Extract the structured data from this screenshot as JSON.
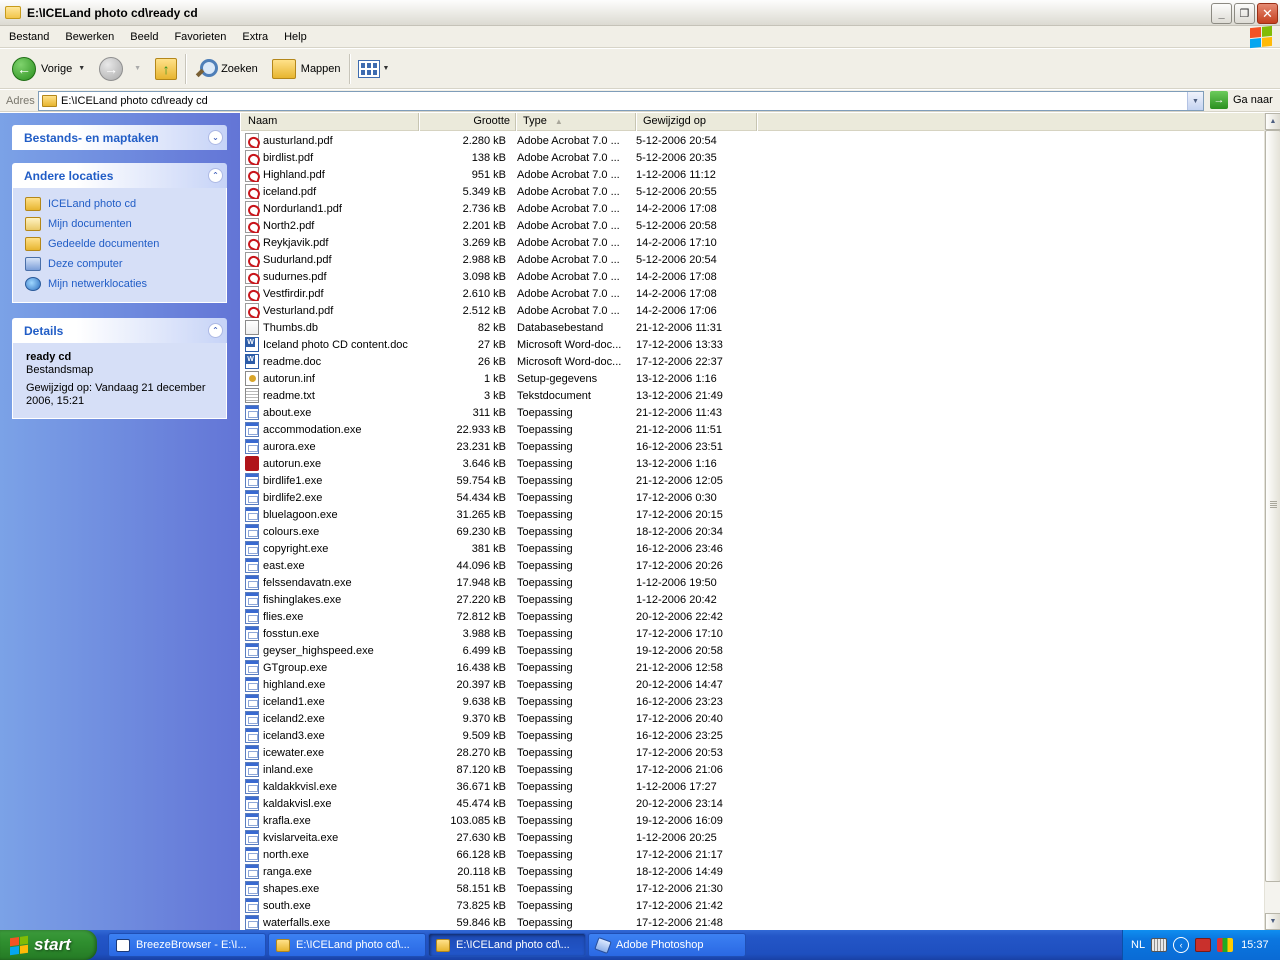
{
  "window": {
    "title": "E:\\ICELand photo cd\\ready cd",
    "minimize": "_",
    "maximize": "❐",
    "close": "✕"
  },
  "menu": [
    "Bestand",
    "Bewerken",
    "Beeld",
    "Favorieten",
    "Extra",
    "Help"
  ],
  "toolbar": {
    "back_label": "Vorige",
    "search_label": "Zoeken",
    "folders_label": "Mappen"
  },
  "address": {
    "label": "Adres",
    "value": "E:\\ICELand photo cd\\ready cd",
    "go_label": "Ga naar"
  },
  "taskpane": {
    "file_tasks_title": "Bestands- en maptaken",
    "other_locations_title": "Andere locaties",
    "other_locations": [
      {
        "label": "ICELand photo cd",
        "icon": "folder-icon"
      },
      {
        "label": "Mijn documenten",
        "icon": "my-documents-icon"
      },
      {
        "label": "Gedeelde documenten",
        "icon": "shared-documents-icon"
      },
      {
        "label": "Deze computer",
        "icon": "computer-icon"
      },
      {
        "label": "Mijn netwerklocaties",
        "icon": "network-icon"
      }
    ],
    "details_title": "Details",
    "details": {
      "name": "ready cd",
      "kind": "Bestandsmap",
      "modified": "Gewijzigd op: Vandaag 21 december 2006, 15:21"
    }
  },
  "columns": {
    "name": "Naam",
    "size": "Grootte",
    "type": "Type",
    "modified": "Gewijzigd op"
  },
  "files": [
    {
      "name": "austurland.pdf",
      "size": "2.280 kB",
      "type": "Adobe Acrobat 7.0 ...",
      "modified": "5-12-2006 20:54",
      "icon": "pdf"
    },
    {
      "name": "birdlist.pdf",
      "size": "138 kB",
      "type": "Adobe Acrobat 7.0 ...",
      "modified": "5-12-2006 20:35",
      "icon": "pdf"
    },
    {
      "name": "Highland.pdf",
      "size": "951 kB",
      "type": "Adobe Acrobat 7.0 ...",
      "modified": "1-12-2006 11:12",
      "icon": "pdf"
    },
    {
      "name": "iceland.pdf",
      "size": "5.349 kB",
      "type": "Adobe Acrobat 7.0 ...",
      "modified": "5-12-2006 20:55",
      "icon": "pdf"
    },
    {
      "name": "Nordurland1.pdf",
      "size": "2.736 kB",
      "type": "Adobe Acrobat 7.0 ...",
      "modified": "14-2-2006 17:08",
      "icon": "pdf"
    },
    {
      "name": "North2.pdf",
      "size": "2.201 kB",
      "type": "Adobe Acrobat 7.0 ...",
      "modified": "5-12-2006 20:58",
      "icon": "pdf"
    },
    {
      "name": "Reykjavik.pdf",
      "size": "3.269 kB",
      "type": "Adobe Acrobat 7.0 ...",
      "modified": "14-2-2006 17:10",
      "icon": "pdf"
    },
    {
      "name": "Sudurland.pdf",
      "size": "2.988 kB",
      "type": "Adobe Acrobat 7.0 ...",
      "modified": "5-12-2006 20:54",
      "icon": "pdf"
    },
    {
      "name": "sudurnes.pdf",
      "size": "3.098 kB",
      "type": "Adobe Acrobat 7.0 ...",
      "modified": "14-2-2006 17:08",
      "icon": "pdf"
    },
    {
      "name": "Vestfirdir.pdf",
      "size": "2.610 kB",
      "type": "Adobe Acrobat 7.0 ...",
      "modified": "14-2-2006 17:08",
      "icon": "pdf"
    },
    {
      "name": "Vesturland.pdf",
      "size": "2.512 kB",
      "type": "Adobe Acrobat 7.0 ...",
      "modified": "14-2-2006 17:06",
      "icon": "pdf"
    },
    {
      "name": "Thumbs.db",
      "size": "82 kB",
      "type": "Databasebestand",
      "modified": "21-12-2006 11:31",
      "icon": "db"
    },
    {
      "name": "Iceland photo CD content.doc",
      "size": "27 kB",
      "type": "Microsoft Word-doc...",
      "modified": "17-12-2006 13:33",
      "icon": "doc"
    },
    {
      "name": "readme.doc",
      "size": "26 kB",
      "type": "Microsoft Word-doc...",
      "modified": "17-12-2006 22:37",
      "icon": "doc"
    },
    {
      "name": "autorun.inf",
      "size": "1 kB",
      "type": "Setup-gegevens",
      "modified": "13-12-2006 1:16",
      "icon": "inf"
    },
    {
      "name": "readme.txt",
      "size": "3 kB",
      "type": "Tekstdocument",
      "modified": "13-12-2006 21:49",
      "icon": "txt"
    },
    {
      "name": "about.exe",
      "size": "311 kB",
      "type": "Toepassing",
      "modified": "21-12-2006 11:43",
      "icon": "exe"
    },
    {
      "name": "accommodation.exe",
      "size": "22.933 kB",
      "type": "Toepassing",
      "modified": "21-12-2006 11:51",
      "icon": "exe"
    },
    {
      "name": "aurora.exe",
      "size": "23.231 kB",
      "type": "Toepassing",
      "modified": "16-12-2006 23:51",
      "icon": "exe"
    },
    {
      "name": "autorun.exe",
      "size": "3.646 kB",
      "type": "Toepassing",
      "modified": "13-12-2006 1:16",
      "icon": "app"
    },
    {
      "name": "birdlife1.exe",
      "size": "59.754 kB",
      "type": "Toepassing",
      "modified": "21-12-2006 12:05",
      "icon": "exe"
    },
    {
      "name": "birdlife2.exe",
      "size": "54.434 kB",
      "type": "Toepassing",
      "modified": "17-12-2006 0:30",
      "icon": "exe"
    },
    {
      "name": "bluelagoon.exe",
      "size": "31.265 kB",
      "type": "Toepassing",
      "modified": "17-12-2006 20:15",
      "icon": "exe"
    },
    {
      "name": "colours.exe",
      "size": "69.230 kB",
      "type": "Toepassing",
      "modified": "18-12-2006 20:34",
      "icon": "exe"
    },
    {
      "name": "copyright.exe",
      "size": "381 kB",
      "type": "Toepassing",
      "modified": "16-12-2006 23:46",
      "icon": "exe"
    },
    {
      "name": "east.exe",
      "size": "44.096 kB",
      "type": "Toepassing",
      "modified": "17-12-2006 20:26",
      "icon": "exe"
    },
    {
      "name": "felssendavatn.exe",
      "size": "17.948 kB",
      "type": "Toepassing",
      "modified": "1-12-2006 19:50",
      "icon": "exe"
    },
    {
      "name": "fishinglakes.exe",
      "size": "27.220 kB",
      "type": "Toepassing",
      "modified": "1-12-2006 20:42",
      "icon": "exe"
    },
    {
      "name": "flies.exe",
      "size": "72.812 kB",
      "type": "Toepassing",
      "modified": "20-12-2006 22:42",
      "icon": "exe"
    },
    {
      "name": "fosstun.exe",
      "size": "3.988 kB",
      "type": "Toepassing",
      "modified": "17-12-2006 17:10",
      "icon": "exe"
    },
    {
      "name": "geyser_highspeed.exe",
      "size": "6.499 kB",
      "type": "Toepassing",
      "modified": "19-12-2006 20:58",
      "icon": "exe"
    },
    {
      "name": "GTgroup.exe",
      "size": "16.438 kB",
      "type": "Toepassing",
      "modified": "21-12-2006 12:58",
      "icon": "exe"
    },
    {
      "name": "highland.exe",
      "size": "20.397 kB",
      "type": "Toepassing",
      "modified": "20-12-2006 14:47",
      "icon": "exe"
    },
    {
      "name": "iceland1.exe",
      "size": "9.638 kB",
      "type": "Toepassing",
      "modified": "16-12-2006 23:23",
      "icon": "exe"
    },
    {
      "name": "iceland2.exe",
      "size": "9.370 kB",
      "type": "Toepassing",
      "modified": "17-12-2006 20:40",
      "icon": "exe"
    },
    {
      "name": "iceland3.exe",
      "size": "9.509 kB",
      "type": "Toepassing",
      "modified": "16-12-2006 23:25",
      "icon": "exe"
    },
    {
      "name": "icewater.exe",
      "size": "28.270 kB",
      "type": "Toepassing",
      "modified": "17-12-2006 20:53",
      "icon": "exe"
    },
    {
      "name": "inland.exe",
      "size": "87.120 kB",
      "type": "Toepassing",
      "modified": "17-12-2006 21:06",
      "icon": "exe"
    },
    {
      "name": "kaldakkvisl.exe",
      "size": "36.671 kB",
      "type": "Toepassing",
      "modified": "1-12-2006 17:27",
      "icon": "exe"
    },
    {
      "name": "kaldakvisl.exe",
      "size": "45.474 kB",
      "type": "Toepassing",
      "modified": "20-12-2006 23:14",
      "icon": "exe"
    },
    {
      "name": "krafla.exe",
      "size": "103.085 kB",
      "type": "Toepassing",
      "modified": "19-12-2006 16:09",
      "icon": "exe"
    },
    {
      "name": "kvislarveita.exe",
      "size": "27.630 kB",
      "type": "Toepassing",
      "modified": "1-12-2006 20:25",
      "icon": "exe"
    },
    {
      "name": "north.exe",
      "size": "66.128 kB",
      "type": "Toepassing",
      "modified": "17-12-2006 21:17",
      "icon": "exe"
    },
    {
      "name": "ranga.exe",
      "size": "20.118 kB",
      "type": "Toepassing",
      "modified": "18-12-2006 14:49",
      "icon": "exe"
    },
    {
      "name": "shapes.exe",
      "size": "58.151 kB",
      "type": "Toepassing",
      "modified": "17-12-2006 21:30",
      "icon": "exe"
    },
    {
      "name": "south.exe",
      "size": "73.825 kB",
      "type": "Toepassing",
      "modified": "17-12-2006 21:42",
      "icon": "exe"
    },
    {
      "name": "waterfalls.exe",
      "size": "59.846 kB",
      "type": "Toepassing",
      "modified": "17-12-2006 21:48",
      "icon": "exe"
    }
  ],
  "taskbar": {
    "start_label": "start",
    "tasks": [
      {
        "label": "BreezeBrowser - E:\\I...",
        "icon": "breeze",
        "active": false
      },
      {
        "label": "E:\\ICELand photo cd\\...",
        "icon": "folder",
        "active": false
      },
      {
        "label": "E:\\ICELand photo cd\\...",
        "icon": "folder",
        "active": true
      },
      {
        "label": "Adobe Photoshop",
        "icon": "ps",
        "active": false
      }
    ],
    "language": "NL",
    "clock": "15:37"
  }
}
